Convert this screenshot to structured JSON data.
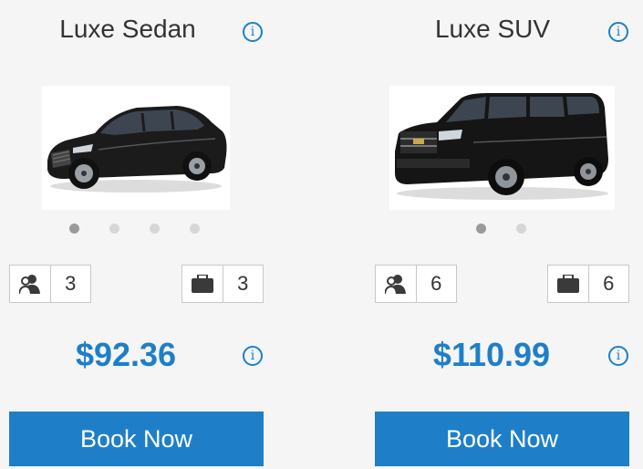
{
  "vehicles": [
    {
      "name": "Luxe Sedan",
      "passengers": "3",
      "luggage": "3",
      "price": "$92.36",
      "book_label": "Book Now",
      "image_count": 4,
      "active_image": 1
    },
    {
      "name": "Luxe SUV",
      "passengers": "6",
      "luggage": "6",
      "price": "$110.99",
      "book_label": "Book Now",
      "image_count": 2,
      "active_image": 1
    }
  ],
  "info_icon_glyph": "i",
  "colors": {
    "accent": "#1e7fc8",
    "text": "#333333",
    "background": "#f5f5f5"
  },
  "icons": {
    "passengers": "passenger-icon",
    "luggage": "briefcase-icon",
    "info": "info-icon"
  }
}
